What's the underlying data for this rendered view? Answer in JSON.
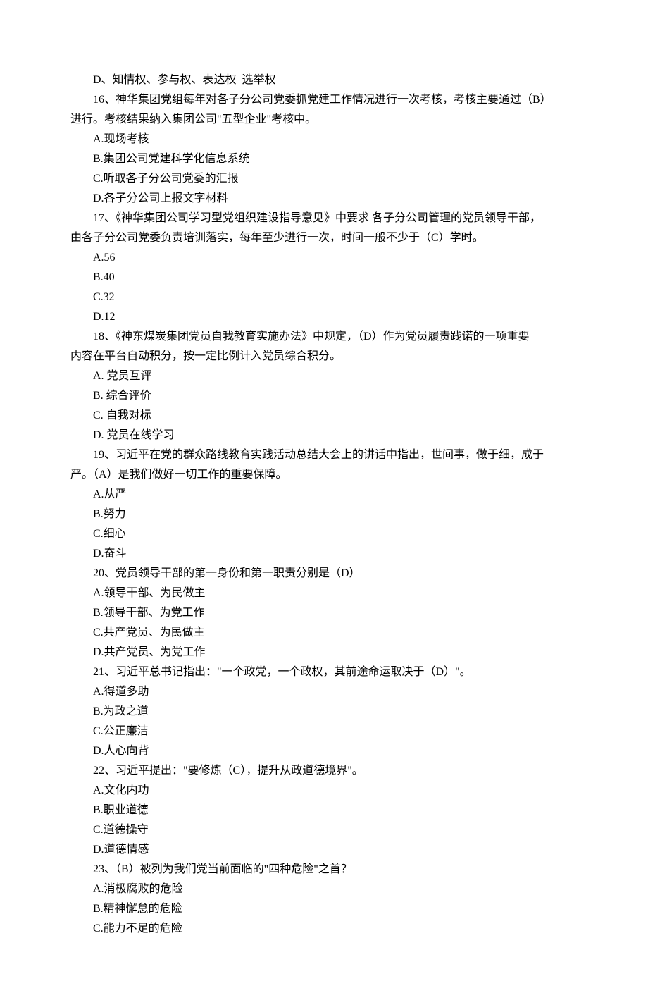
{
  "lines": [
    {
      "indent": true,
      "text": "D、知情权、参与权、表达权  选举权"
    },
    {
      "indent": true,
      "text": "16、神华集团党组每年对各子分公司党委抓党建工作情况进行一次考核，考核主要通过（B）"
    },
    {
      "indent": false,
      "text": "进行。考核结果纳入集团公司\"五型企业\"考核中。"
    },
    {
      "indent": true,
      "text": "A.现场考核"
    },
    {
      "indent": true,
      "text": "B.集团公司党建科学化信息系统"
    },
    {
      "indent": true,
      "text": "C.听取各子分公司党委的汇报"
    },
    {
      "indent": true,
      "text": "D.各子分公司上报文字材料"
    },
    {
      "indent": true,
      "text": "17、《神华集团公司学习型党组织建设指导意见》中要求 各子分公司管理的党员领导干部，"
    },
    {
      "indent": false,
      "text": "由各子分公司党委负责培训落实，每年至少进行一次，时间一般不少于（C）学时。"
    },
    {
      "indent": true,
      "text": "A.56"
    },
    {
      "indent": true,
      "text": "B.40"
    },
    {
      "indent": true,
      "text": "C.32"
    },
    {
      "indent": true,
      "text": "D.12"
    },
    {
      "indent": true,
      "text": "18、《神东煤炭集团党员自我教育实施办法》中规定，（D）作为党员履责践诺的一项重要"
    },
    {
      "indent": false,
      "text": "内容在平台自动积分，按一定比例计入党员综合积分。"
    },
    {
      "indent": true,
      "text": "A. 党员互评"
    },
    {
      "indent": true,
      "text": "B. 综合评价"
    },
    {
      "indent": true,
      "text": "C. 自我对标"
    },
    {
      "indent": true,
      "text": "D. 党员在线学习"
    },
    {
      "indent": true,
      "text": "19、习近平在党的群众路线教育实践活动总结大会上的讲话中指出，世间事，做于细，成于"
    },
    {
      "indent": false,
      "text": "严。（A）是我们做好一切工作的重要保障。"
    },
    {
      "indent": true,
      "text": "A.从严"
    },
    {
      "indent": true,
      "text": "B.努力"
    },
    {
      "indent": true,
      "text": "C.细心"
    },
    {
      "indent": true,
      "text": "D.奋斗"
    },
    {
      "indent": true,
      "text": "20、党员领导干部的第一身份和第一职责分别是（D）"
    },
    {
      "indent": true,
      "text": "A.领导干部、为民做主"
    },
    {
      "indent": true,
      "text": "B.领导干部、为党工作"
    },
    {
      "indent": true,
      "text": "C.共产党员、为民做主"
    },
    {
      "indent": true,
      "text": "D.共产党员、为党工作"
    },
    {
      "indent": true,
      "text": "21、习近平总书记指出：\"一个政党，一个政权，其前途命运取决于（D）\"。"
    },
    {
      "indent": true,
      "text": "A.得道多助"
    },
    {
      "indent": true,
      "text": "B.为政之道"
    },
    {
      "indent": true,
      "text": "C.公正廉洁"
    },
    {
      "indent": true,
      "text": "D.人心向背"
    },
    {
      "indent": true,
      "text": "22、习近平提出：\"要修炼（C），提升从政道德境界\"。"
    },
    {
      "indent": true,
      "text": "A.文化内功"
    },
    {
      "indent": true,
      "text": "B.职业道德"
    },
    {
      "indent": true,
      "text": "C.道德操守"
    },
    {
      "indent": true,
      "text": "D.道德情感"
    },
    {
      "indent": true,
      "text": "23、（B）被列为我们党当前面临的\"四种危险\"之首？"
    },
    {
      "indent": true,
      "text": "A.消极腐败的危险"
    },
    {
      "indent": true,
      "text": "B.精神懈怠的危险"
    },
    {
      "indent": true,
      "text": "C.能力不足的危险"
    }
  ]
}
